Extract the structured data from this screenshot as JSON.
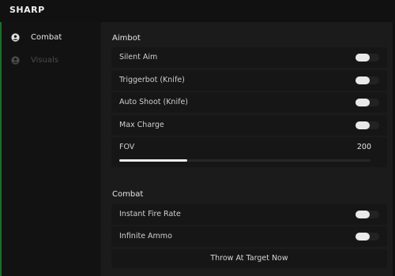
{
  "app": {
    "title": "SHARP"
  },
  "sidebar": {
    "items": [
      {
        "label": "Combat",
        "icon": "user-icon",
        "active": true
      },
      {
        "label": "Visuals",
        "icon": "user-icon",
        "active": false
      }
    ]
  },
  "aimbot": {
    "title": "Aimbot",
    "toggles": [
      {
        "label": "Silent Aim",
        "on": false
      },
      {
        "label": "Triggerbot (Knife)",
        "on": false
      },
      {
        "label": "Auto Shoot (Knife)",
        "on": false
      },
      {
        "label": "Max Charge",
        "on": false
      }
    ],
    "fov": {
      "label": "FOV",
      "value": "200",
      "fill_fraction": 0.27
    }
  },
  "combat": {
    "title": "Combat",
    "toggles": [
      {
        "label": "Instant Fire Rate",
        "on": false
      },
      {
        "label": "Infinite Ammo",
        "on": false
      }
    ],
    "button_label": "Throw At Target Now"
  },
  "colors": {
    "background": "#141414",
    "panel": "#1b1b1b",
    "row": "#161616",
    "accent_line": "#1f6b2e",
    "toggle_knob": "#e9e9e9",
    "text_inactive": "#4b4b4b"
  }
}
